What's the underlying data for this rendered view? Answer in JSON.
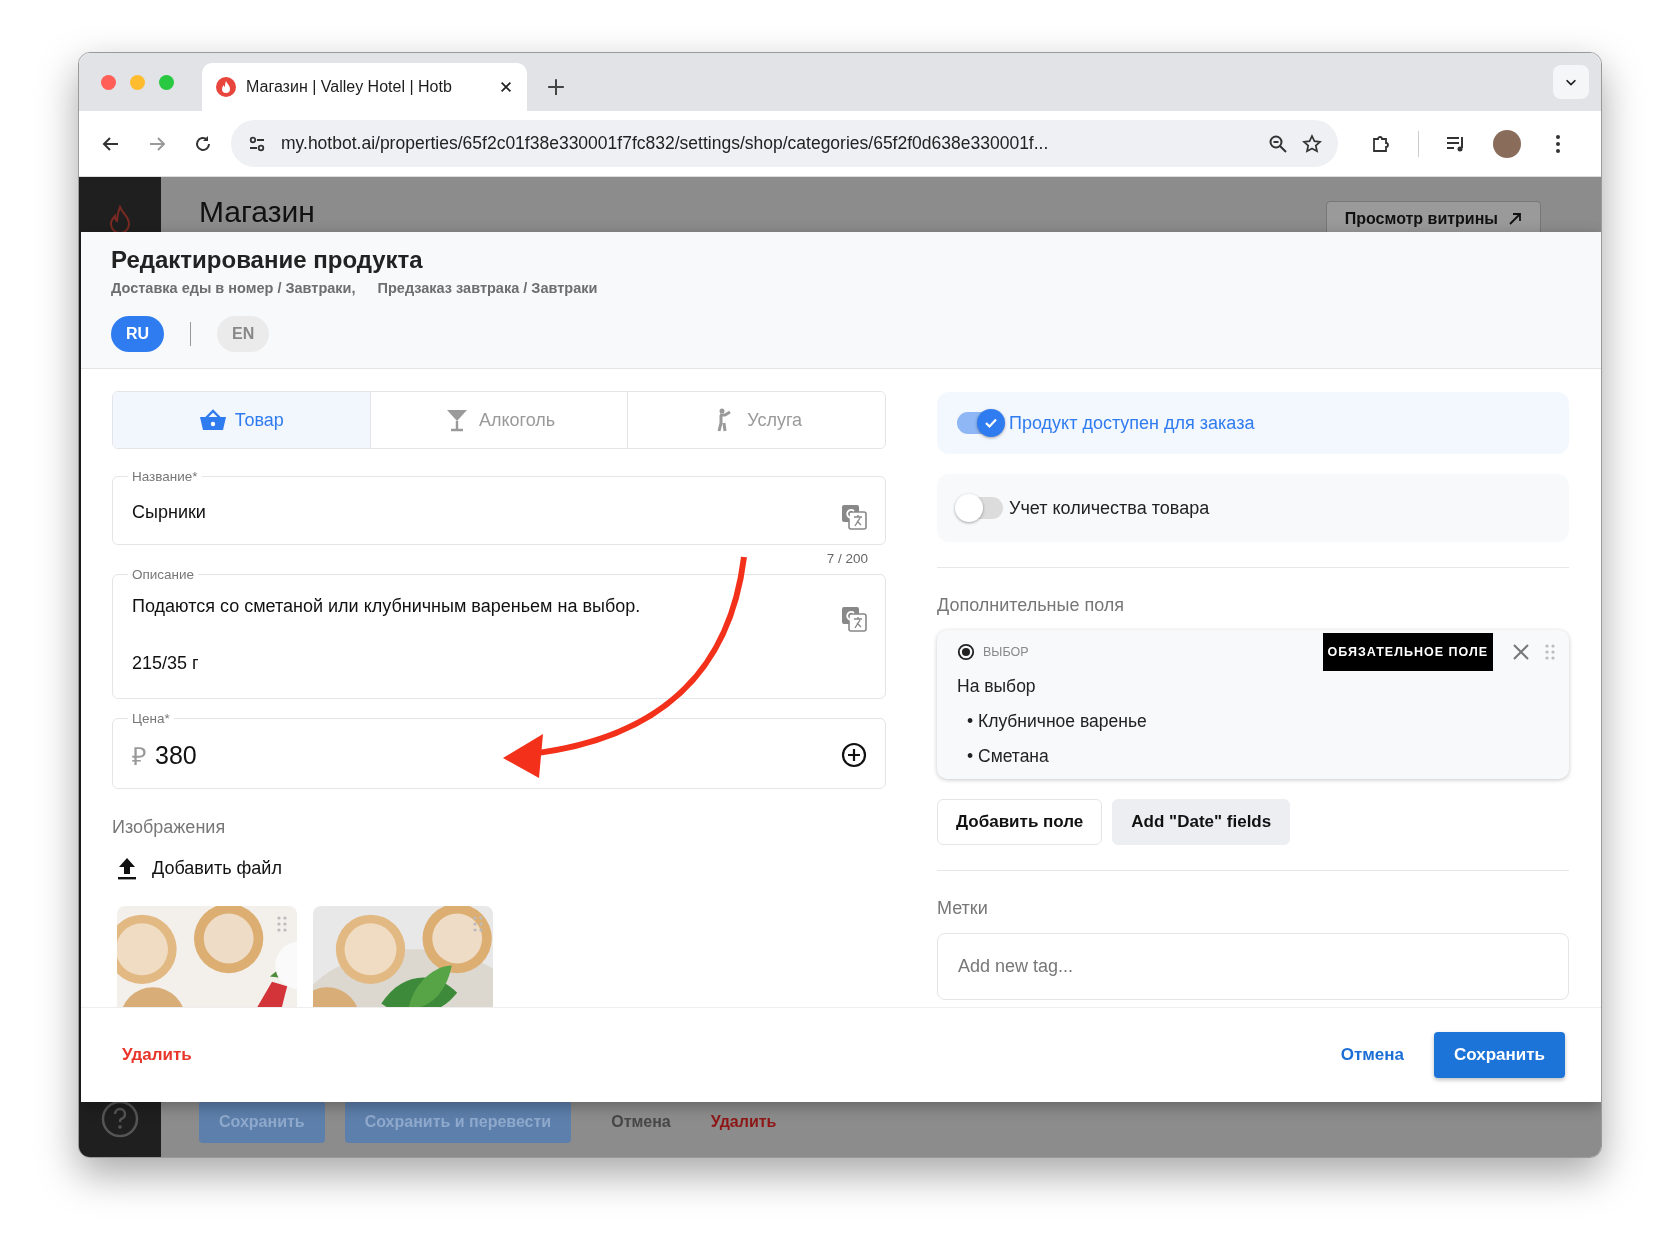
{
  "browser": {
    "tab_title": "Магазин | Valley Hotel | Hotb",
    "url": "my.hotbot.ai/properties/65f2c01f38e330001f7fc832/settings/shop/categories/65f2f0d638e330001f..."
  },
  "page": {
    "title": "Магазин",
    "storefront_button": "Просмотр витрины"
  },
  "background_actions": [
    {
      "label": "Сохранить",
      "kind": "primary"
    },
    {
      "label": "Сохранить и перевести",
      "kind": "primary"
    },
    {
      "label": "Отмена",
      "kind": "plain"
    },
    {
      "label": "Удалить",
      "kind": "danger"
    }
  ],
  "modal": {
    "title": "Редактирование продукта",
    "breadcrumbs": [
      "Доставка еды в номер / Завтраки,",
      "Предзаказ завтрака / Завтраки"
    ],
    "languages": [
      {
        "label": "RU",
        "selected": true
      },
      {
        "label": "EN",
        "selected": false
      }
    ],
    "product_types": [
      {
        "label": "Товар",
        "kind": "basket",
        "selected": true
      },
      {
        "label": "Алкоголь",
        "kind": "glass",
        "selected": false
      },
      {
        "label": "Услуга",
        "kind": "person",
        "selected": false
      }
    ],
    "name_field": {
      "label": "Название*",
      "value": "Сырники",
      "counter": "7 / 200"
    },
    "description_field": {
      "label": "Описание",
      "lines": [
        "Подаются со сметаной или клубничным вареньем на выбор.",
        "215/35 г"
      ]
    },
    "price_field": {
      "label": "Цена*",
      "currency": "₽",
      "value": "380"
    },
    "images": {
      "title": "Изображения",
      "add_button": "Добавить файл"
    },
    "toggles": [
      {
        "label": "Продукт доступен для заказа",
        "on": true
      },
      {
        "label": "Учет количества товара",
        "on": false
      }
    ],
    "extra_fields": {
      "title": "Дополнительные поля",
      "items": [
        {
          "type_label": "ВЫБОР",
          "required_badge": "ОБЯЗАТЕЛЬНОЕ ПОЛЕ",
          "title": "На выбор",
          "options": [
            "• Клубничное варенье",
            "• Сметана"
          ]
        }
      ],
      "buttons": [
        {
          "label": "Добавить поле",
          "kind": "outline"
        },
        {
          "label": "Add \"Date\" fields",
          "kind": "filled"
        }
      ]
    },
    "tags": {
      "title": "Метки",
      "placeholder": "Add new tag..."
    },
    "footer": {
      "delete": "Удалить",
      "cancel": "Отмена",
      "save": "Сохранить"
    }
  }
}
